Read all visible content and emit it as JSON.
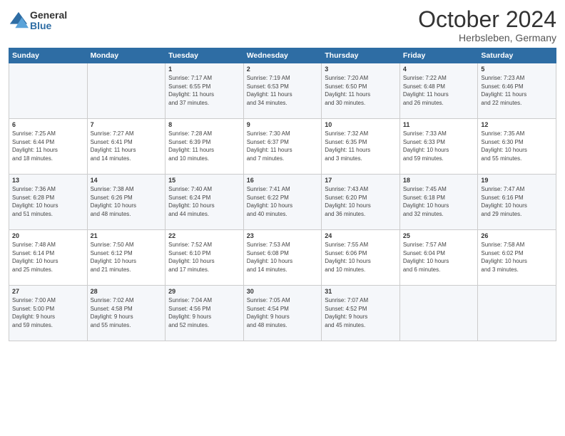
{
  "header": {
    "logo_line1": "General",
    "logo_line2": "Blue",
    "month": "October 2024",
    "location": "Herbsleben, Germany"
  },
  "days_of_week": [
    "Sunday",
    "Monday",
    "Tuesday",
    "Wednesday",
    "Thursday",
    "Friday",
    "Saturday"
  ],
  "weeks": [
    [
      {
        "day": "",
        "info": ""
      },
      {
        "day": "",
        "info": ""
      },
      {
        "day": "1",
        "info": "Sunrise: 7:17 AM\nSunset: 6:55 PM\nDaylight: 11 hours\nand 37 minutes."
      },
      {
        "day": "2",
        "info": "Sunrise: 7:19 AM\nSunset: 6:53 PM\nDaylight: 11 hours\nand 34 minutes."
      },
      {
        "day": "3",
        "info": "Sunrise: 7:20 AM\nSunset: 6:50 PM\nDaylight: 11 hours\nand 30 minutes."
      },
      {
        "day": "4",
        "info": "Sunrise: 7:22 AM\nSunset: 6:48 PM\nDaylight: 11 hours\nand 26 minutes."
      },
      {
        "day": "5",
        "info": "Sunrise: 7:23 AM\nSunset: 6:46 PM\nDaylight: 11 hours\nand 22 minutes."
      }
    ],
    [
      {
        "day": "6",
        "info": "Sunrise: 7:25 AM\nSunset: 6:44 PM\nDaylight: 11 hours\nand 18 minutes."
      },
      {
        "day": "7",
        "info": "Sunrise: 7:27 AM\nSunset: 6:41 PM\nDaylight: 11 hours\nand 14 minutes."
      },
      {
        "day": "8",
        "info": "Sunrise: 7:28 AM\nSunset: 6:39 PM\nDaylight: 11 hours\nand 10 minutes."
      },
      {
        "day": "9",
        "info": "Sunrise: 7:30 AM\nSunset: 6:37 PM\nDaylight: 11 hours\nand 7 minutes."
      },
      {
        "day": "10",
        "info": "Sunrise: 7:32 AM\nSunset: 6:35 PM\nDaylight: 11 hours\nand 3 minutes."
      },
      {
        "day": "11",
        "info": "Sunrise: 7:33 AM\nSunset: 6:33 PM\nDaylight: 10 hours\nand 59 minutes."
      },
      {
        "day": "12",
        "info": "Sunrise: 7:35 AM\nSunset: 6:30 PM\nDaylight: 10 hours\nand 55 minutes."
      }
    ],
    [
      {
        "day": "13",
        "info": "Sunrise: 7:36 AM\nSunset: 6:28 PM\nDaylight: 10 hours\nand 51 minutes."
      },
      {
        "day": "14",
        "info": "Sunrise: 7:38 AM\nSunset: 6:26 PM\nDaylight: 10 hours\nand 48 minutes."
      },
      {
        "day": "15",
        "info": "Sunrise: 7:40 AM\nSunset: 6:24 PM\nDaylight: 10 hours\nand 44 minutes."
      },
      {
        "day": "16",
        "info": "Sunrise: 7:41 AM\nSunset: 6:22 PM\nDaylight: 10 hours\nand 40 minutes."
      },
      {
        "day": "17",
        "info": "Sunrise: 7:43 AM\nSunset: 6:20 PM\nDaylight: 10 hours\nand 36 minutes."
      },
      {
        "day": "18",
        "info": "Sunrise: 7:45 AM\nSunset: 6:18 PM\nDaylight: 10 hours\nand 32 minutes."
      },
      {
        "day": "19",
        "info": "Sunrise: 7:47 AM\nSunset: 6:16 PM\nDaylight: 10 hours\nand 29 minutes."
      }
    ],
    [
      {
        "day": "20",
        "info": "Sunrise: 7:48 AM\nSunset: 6:14 PM\nDaylight: 10 hours\nand 25 minutes."
      },
      {
        "day": "21",
        "info": "Sunrise: 7:50 AM\nSunset: 6:12 PM\nDaylight: 10 hours\nand 21 minutes."
      },
      {
        "day": "22",
        "info": "Sunrise: 7:52 AM\nSunset: 6:10 PM\nDaylight: 10 hours\nand 17 minutes."
      },
      {
        "day": "23",
        "info": "Sunrise: 7:53 AM\nSunset: 6:08 PM\nDaylight: 10 hours\nand 14 minutes."
      },
      {
        "day": "24",
        "info": "Sunrise: 7:55 AM\nSunset: 6:06 PM\nDaylight: 10 hours\nand 10 minutes."
      },
      {
        "day": "25",
        "info": "Sunrise: 7:57 AM\nSunset: 6:04 PM\nDaylight: 10 hours\nand 6 minutes."
      },
      {
        "day": "26",
        "info": "Sunrise: 7:58 AM\nSunset: 6:02 PM\nDaylight: 10 hours\nand 3 minutes."
      }
    ],
    [
      {
        "day": "27",
        "info": "Sunrise: 7:00 AM\nSunset: 5:00 PM\nDaylight: 9 hours\nand 59 minutes."
      },
      {
        "day": "28",
        "info": "Sunrise: 7:02 AM\nSunset: 4:58 PM\nDaylight: 9 hours\nand 55 minutes."
      },
      {
        "day": "29",
        "info": "Sunrise: 7:04 AM\nSunset: 4:56 PM\nDaylight: 9 hours\nand 52 minutes."
      },
      {
        "day": "30",
        "info": "Sunrise: 7:05 AM\nSunset: 4:54 PM\nDaylight: 9 hours\nand 48 minutes."
      },
      {
        "day": "31",
        "info": "Sunrise: 7:07 AM\nSunset: 4:52 PM\nDaylight: 9 hours\nand 45 minutes."
      },
      {
        "day": "",
        "info": ""
      },
      {
        "day": "",
        "info": ""
      }
    ]
  ]
}
